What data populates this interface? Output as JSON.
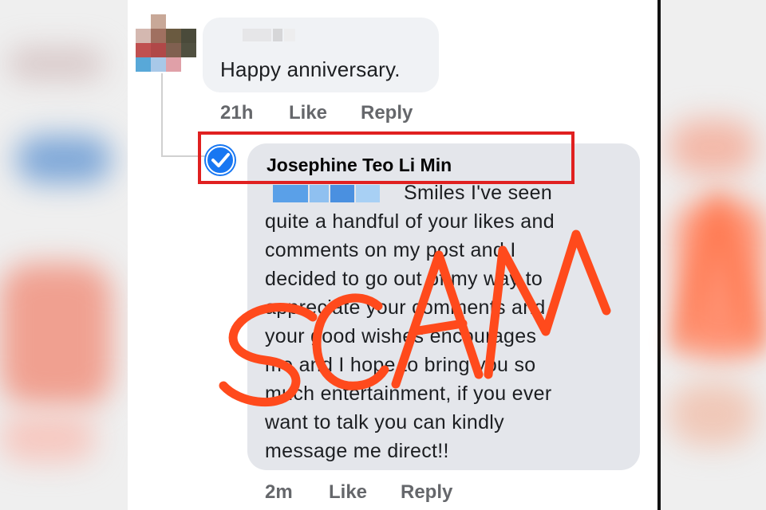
{
  "first_comment": {
    "text": "Happy anniversary.",
    "time": "21h",
    "like_label": "Like",
    "reply_label": "Reply"
  },
  "reply_comment": {
    "author": "Josephine Teo Li Min",
    "lines": [
      "Smiles I've seen",
      "quite a handful of your likes and",
      "comments on my post and I",
      "decided to go out of my way to",
      "appreciate your comments and",
      "your good wishes encourages",
      "me and I hope to bring you so",
      "much entertainment, if you ever",
      "want to talk you can kindly",
      "message me direct!!"
    ],
    "time": "2m",
    "like_label": "Like",
    "reply_label": "Reply"
  },
  "overlay": {
    "stamp_text": "SCAM",
    "stamp_color": "#ff4a1c",
    "highlight_color": "#e02020"
  },
  "colors": {
    "verified_badge": "#1877f2",
    "bubble_light": "#f0f2f5",
    "bubble_reply": "#e4e6eb",
    "meta_text": "#65676b"
  },
  "icons": {
    "verified": "verified-check-icon"
  }
}
